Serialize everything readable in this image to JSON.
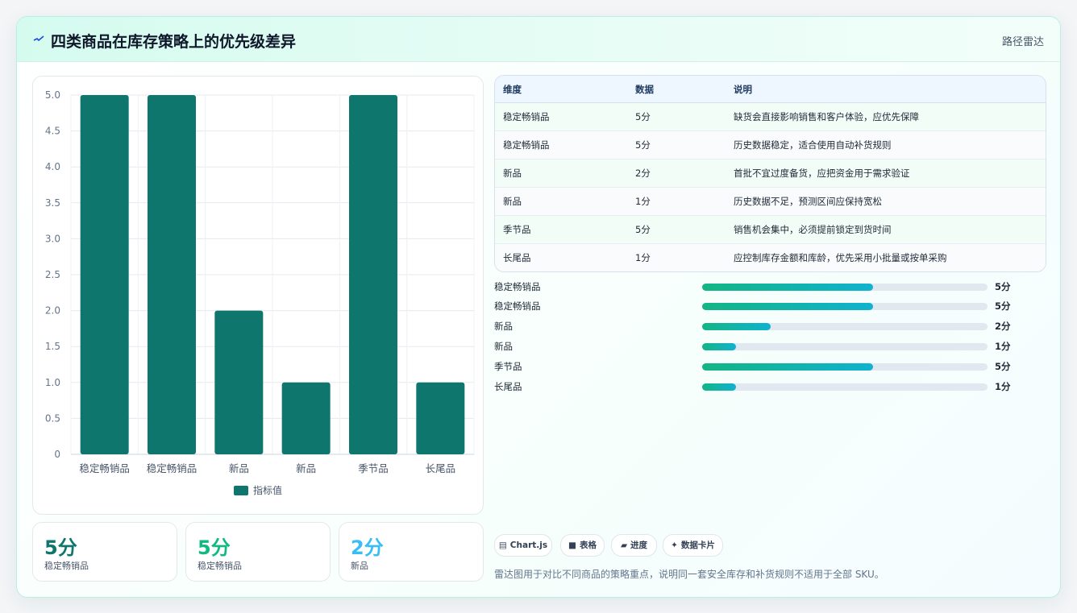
{
  "header": {
    "title": "四类商品在库存策略上的优先级差异",
    "right_label": "路径雷达"
  },
  "chart_data": {
    "type": "bar",
    "categories": [
      "稳定畅销品",
      "稳定畅销品",
      "新品",
      "新品",
      "季节品",
      "长尾品"
    ],
    "series": [
      {
        "name": "指标值",
        "values": [
          5,
          5,
          2,
          1,
          5,
          1
        ],
        "color": "#0f766e"
      }
    ],
    "yticks": [
      "0",
      "0.5",
      "1.0",
      "1.5",
      "2.0",
      "2.5",
      "3.0",
      "3.5",
      "4.0",
      "4.5",
      "5.0"
    ],
    "ylim": [
      0,
      5
    ],
    "grid": true,
    "legend": "bottom"
  },
  "kpis": [
    {
      "value": "5分",
      "label": "稳定畅销品",
      "color": "#0f766e"
    },
    {
      "value": "5分",
      "label": "稳定畅销品",
      "color": "#10b981"
    },
    {
      "value": "2分",
      "label": "新品",
      "color": "#38bdf8"
    }
  ],
  "table": {
    "headers": [
      "维度",
      "数据",
      "说明"
    ],
    "rows": [
      [
        "稳定畅销品",
        "5分",
        "缺货会直接影响销售和客户体验，应优先保障"
      ],
      [
        "稳定畅销品",
        "5分",
        "历史数据稳定，适合使用自动补货规则"
      ],
      [
        "新品",
        "2分",
        "首批不宜过度备货，应把资金用于需求验证"
      ],
      [
        "新品",
        "1分",
        "历史数据不足，预测区间应保持宽松"
      ],
      [
        "季节品",
        "5分",
        "销售机会集中，必须提前锁定到货时间"
      ],
      [
        "长尾品",
        "1分",
        "应控制库存金额和库龄，优先采用小批量或按单采购"
      ]
    ]
  },
  "progress": [
    {
      "label": "稳定畅销品",
      "value_text": "5分",
      "fraction": 0.6
    },
    {
      "label": "稳定畅销品",
      "value_text": "5分",
      "fraction": 0.6
    },
    {
      "label": "新品",
      "value_text": "2分",
      "fraction": 0.24
    },
    {
      "label": "新品",
      "value_text": "1分",
      "fraction": 0.12
    },
    {
      "label": "季节品",
      "value_text": "5分",
      "fraction": 0.6
    },
    {
      "label": "长尾品",
      "value_text": "1分",
      "fraction": 0.12
    }
  ],
  "chips": [
    {
      "icon": "chart-icon",
      "glyph": "▤",
      "label": "Chart.js"
    },
    {
      "icon": "table-icon",
      "glyph": "■",
      "label": "表格"
    },
    {
      "icon": "progress-icon",
      "glyph": "▰",
      "label": "进度"
    },
    {
      "icon": "sparkle-icon",
      "glyph": "✦",
      "label": "数据卡片"
    }
  ],
  "footnote": "雷达图用于对比不同商品的策略重点，说明同一套安全库存和补货规则不适用于全部 SKU。"
}
